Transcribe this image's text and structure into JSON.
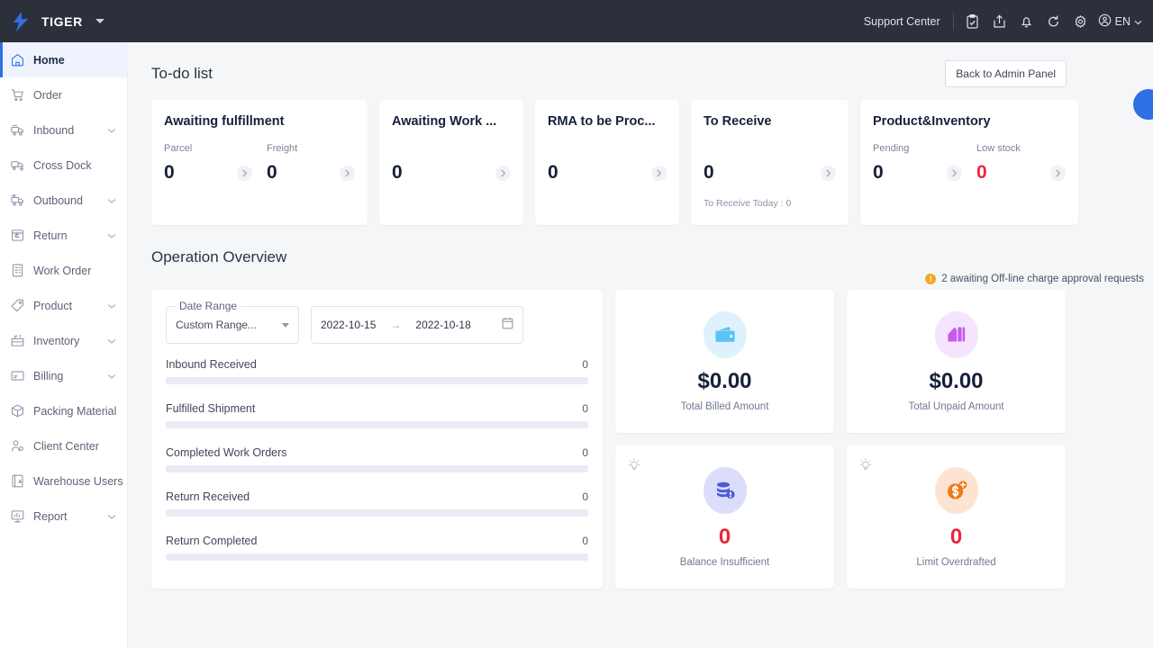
{
  "topbar": {
    "brand": "TIGER",
    "brand_caret": "caret-down",
    "support": "Support Center",
    "lang": "EN",
    "icons": [
      "clipboard-check-icon",
      "export-icon",
      "bell-icon",
      "refresh-icon",
      "gear-icon",
      "user-avatar-icon"
    ]
  },
  "sidebar": {
    "items": [
      {
        "label": "Home",
        "icon": "home-icon",
        "active": true,
        "expandable": false
      },
      {
        "label": "Order",
        "icon": "cart-icon",
        "active": false,
        "expandable": false
      },
      {
        "label": "Inbound",
        "icon": "inbound-truck-icon",
        "active": false,
        "expandable": true
      },
      {
        "label": "Cross Dock",
        "icon": "cross-dock-icon",
        "active": false,
        "expandable": false
      },
      {
        "label": "Outbound",
        "icon": "outbound-truck-icon",
        "active": false,
        "expandable": true
      },
      {
        "label": "Return",
        "icon": "return-box-icon",
        "active": false,
        "expandable": true
      },
      {
        "label": "Work Order",
        "icon": "work-order-icon",
        "active": false,
        "expandable": false
      },
      {
        "label": "Product",
        "icon": "tag-icon",
        "active": false,
        "expandable": true
      },
      {
        "label": "Inventory",
        "icon": "inventory-icon",
        "active": false,
        "expandable": true
      },
      {
        "label": "Billing",
        "icon": "billing-card-icon",
        "active": false,
        "expandable": true
      },
      {
        "label": "Packing Material",
        "icon": "package-icon",
        "active": false,
        "expandable": false
      },
      {
        "label": "Client Center",
        "icon": "client-user-icon",
        "active": false,
        "expandable": false
      },
      {
        "label": "Warehouse Users",
        "icon": "warehouse-users-icon",
        "active": false,
        "expandable": true
      },
      {
        "label": "Report",
        "icon": "report-icon",
        "active": false,
        "expandable": true
      }
    ]
  },
  "todo": {
    "title": "To-do list",
    "admin_button": "Back to Admin Panel",
    "cards": [
      {
        "title": "Awaiting fulfillment",
        "metrics": [
          {
            "label": "Parcel",
            "value": "0",
            "danger": false
          },
          {
            "label": "Freight",
            "value": "0",
            "danger": false
          }
        ],
        "note": ""
      },
      {
        "title": "Awaiting Work ...",
        "metrics": [
          {
            "label": "",
            "value": "0",
            "danger": false
          }
        ],
        "note": ""
      },
      {
        "title": "RMA to be Proc...",
        "metrics": [
          {
            "label": "",
            "value": "0",
            "danger": false
          }
        ],
        "note": ""
      },
      {
        "title": "To Receive",
        "metrics": [
          {
            "label": "",
            "value": "0",
            "danger": false
          }
        ],
        "note": "To Receive Today : 0"
      },
      {
        "title": "Product&Inventory",
        "metrics": [
          {
            "label": "Pending",
            "value": "0",
            "danger": false
          },
          {
            "label": "Low stock",
            "value": "0",
            "danger": true
          }
        ],
        "note": ""
      }
    ]
  },
  "overview": {
    "title": "Operation Overview",
    "warning": {
      "text": "2 awaiting Off-line charge approval requests",
      "icon": "warning-icon",
      "color": "#f5a623"
    },
    "filters": {
      "date_range_legend": "Date Range",
      "date_range_value": "Custom Range...",
      "start_date": "2022-10-15",
      "end_date": "2022-10-18",
      "range_arrow": "→",
      "calendar_icon": "calendar-icon"
    },
    "metrics": [
      {
        "label": "Inbound Received",
        "value": "0",
        "percent": 0
      },
      {
        "label": "Fulfilled Shipment",
        "value": "0",
        "percent": 0
      },
      {
        "label": "Completed Work Orders",
        "value": "0",
        "percent": 0
      },
      {
        "label": "Return Received",
        "value": "0",
        "percent": 0
      },
      {
        "label": "Return Completed",
        "value": "0",
        "percent": 0
      }
    ],
    "money_cards": [
      {
        "value": "$0.00",
        "caption": "Total Billed Amount",
        "icon": "wallet-icon",
        "icon_color": "#5cc3f2",
        "icon_bg": "#ddf2fd",
        "danger": false,
        "bulb": false
      },
      {
        "value": "$0.00",
        "caption": "Total Unpaid Amount",
        "icon": "money-bill-icon",
        "icon_color": "#c65cf0",
        "icon_bg": "#f6e4fd",
        "danger": false,
        "bulb": false
      },
      {
        "value": "0",
        "caption": "Balance Insufficient",
        "icon": "coins-alert-icon",
        "icon_color": "#4a5bd8",
        "icon_bg": "#dcdcfb",
        "danger": true,
        "bulb": true
      },
      {
        "value": "0",
        "caption": "Limit Overdrafted",
        "icon": "dollar-plus-icon",
        "icon_color": "#f07818",
        "icon_bg": "#fde4d2",
        "danger": true,
        "bulb": true
      }
    ]
  },
  "fab": {
    "name": "floating-action-button",
    "color": "#2f6fe4"
  }
}
